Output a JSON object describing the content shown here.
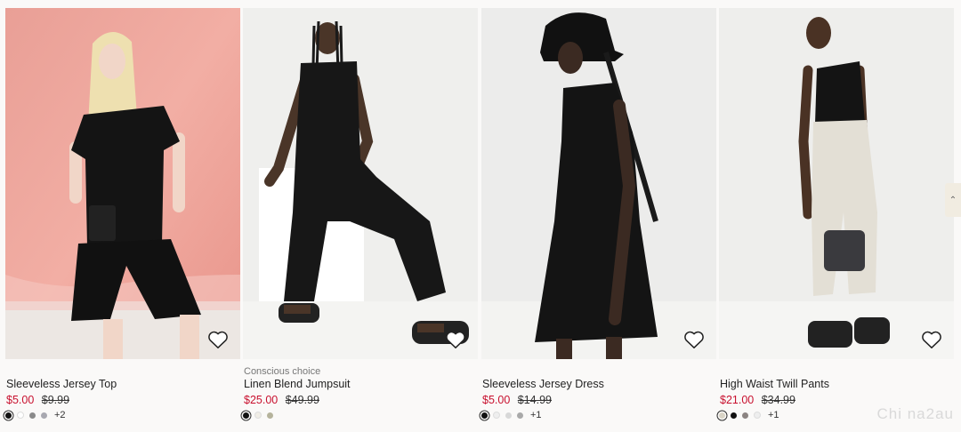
{
  "products": [
    {
      "badge": "",
      "title": "Sleeveless Jersey Top",
      "sale_price": "$5.00",
      "original_price": "$9.99",
      "swatches": [
        "#111111",
        "#ffffff",
        "#8a8a8a",
        "#a8a8b0"
      ],
      "more_colors": "+2",
      "favorite_icon": "heart-outline-icon"
    },
    {
      "badge": "Conscious choice",
      "title": "Linen Blend Jumpsuit",
      "sale_price": "$25.00",
      "original_price": "$49.99",
      "swatches": [
        "#111111",
        "#f0ede6",
        "#b5b39c"
      ],
      "more_colors": "",
      "favorite_icon": "heart-outline-icon"
    },
    {
      "badge": "",
      "title": "Sleeveless Jersey Dress",
      "sale_price": "$5.00",
      "original_price": "$14.99",
      "swatches": [
        "#111111",
        "#eeeeee",
        "#d8d8d8",
        "#a9a9a9"
      ],
      "more_colors": "+1",
      "favorite_icon": "heart-outline-icon"
    },
    {
      "badge": "",
      "title": "High Waist Twill Pants",
      "sale_price": "$21.00",
      "original_price": "$34.99",
      "swatches": [
        "#d9d4c6",
        "#111111",
        "#8c8482",
        "#eeeeee"
      ],
      "more_colors": "+1",
      "favorite_icon": "heart-outline-icon"
    }
  ],
  "scroll_tab_icon": "chevron-up-icon",
  "watermark": "Chi na2au",
  "colors": {
    "sale": "#c8102e",
    "background": "#faf9f8"
  }
}
